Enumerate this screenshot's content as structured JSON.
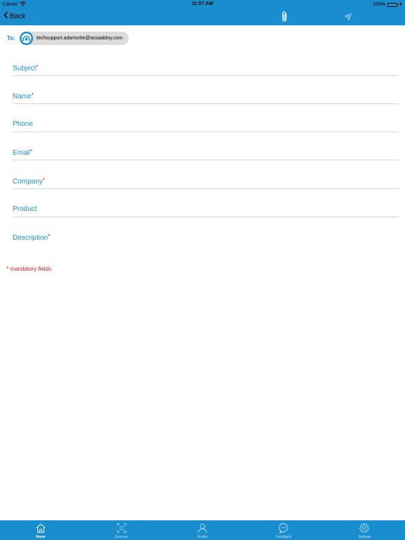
{
  "status_bar": {
    "carrier": "Carrier",
    "time": "11:07 AM",
    "battery": "100%",
    "battery_level": 1.0
  },
  "nav": {
    "back_label": "Back"
  },
  "to_row": {
    "label": "To:",
    "recipient": "techsupport.adamsrite@assaabloy.com"
  },
  "form": {
    "required_marker": "*",
    "fields": [
      {
        "label": "Subject",
        "required": true
      },
      {
        "label": "Name",
        "required": true
      },
      {
        "label": "Phone",
        "required": false
      },
      {
        "label": "Email",
        "required": true
      },
      {
        "label": "Company",
        "required": true
      },
      {
        "label": "Product",
        "required": false
      }
    ],
    "description": {
      "label": "Description",
      "required": true
    },
    "mandatory_note": "* mandatory fields"
  },
  "tabs": [
    {
      "label": "Home",
      "icon": "home-icon",
      "active": true
    },
    {
      "label": "Scanner",
      "icon": "scanner-icon",
      "active": false
    },
    {
      "label": "Profile",
      "icon": "profile-icon",
      "active": false
    },
    {
      "label": "Feedback",
      "icon": "feedback-icon",
      "active": false
    },
    {
      "label": "Settings",
      "icon": "settings-icon",
      "active": false
    }
  ],
  "colors": {
    "accent": "#1a8dcf",
    "required": "#e5161b",
    "divider": "#d7d7d7",
    "chip": "#dcdcdc"
  }
}
